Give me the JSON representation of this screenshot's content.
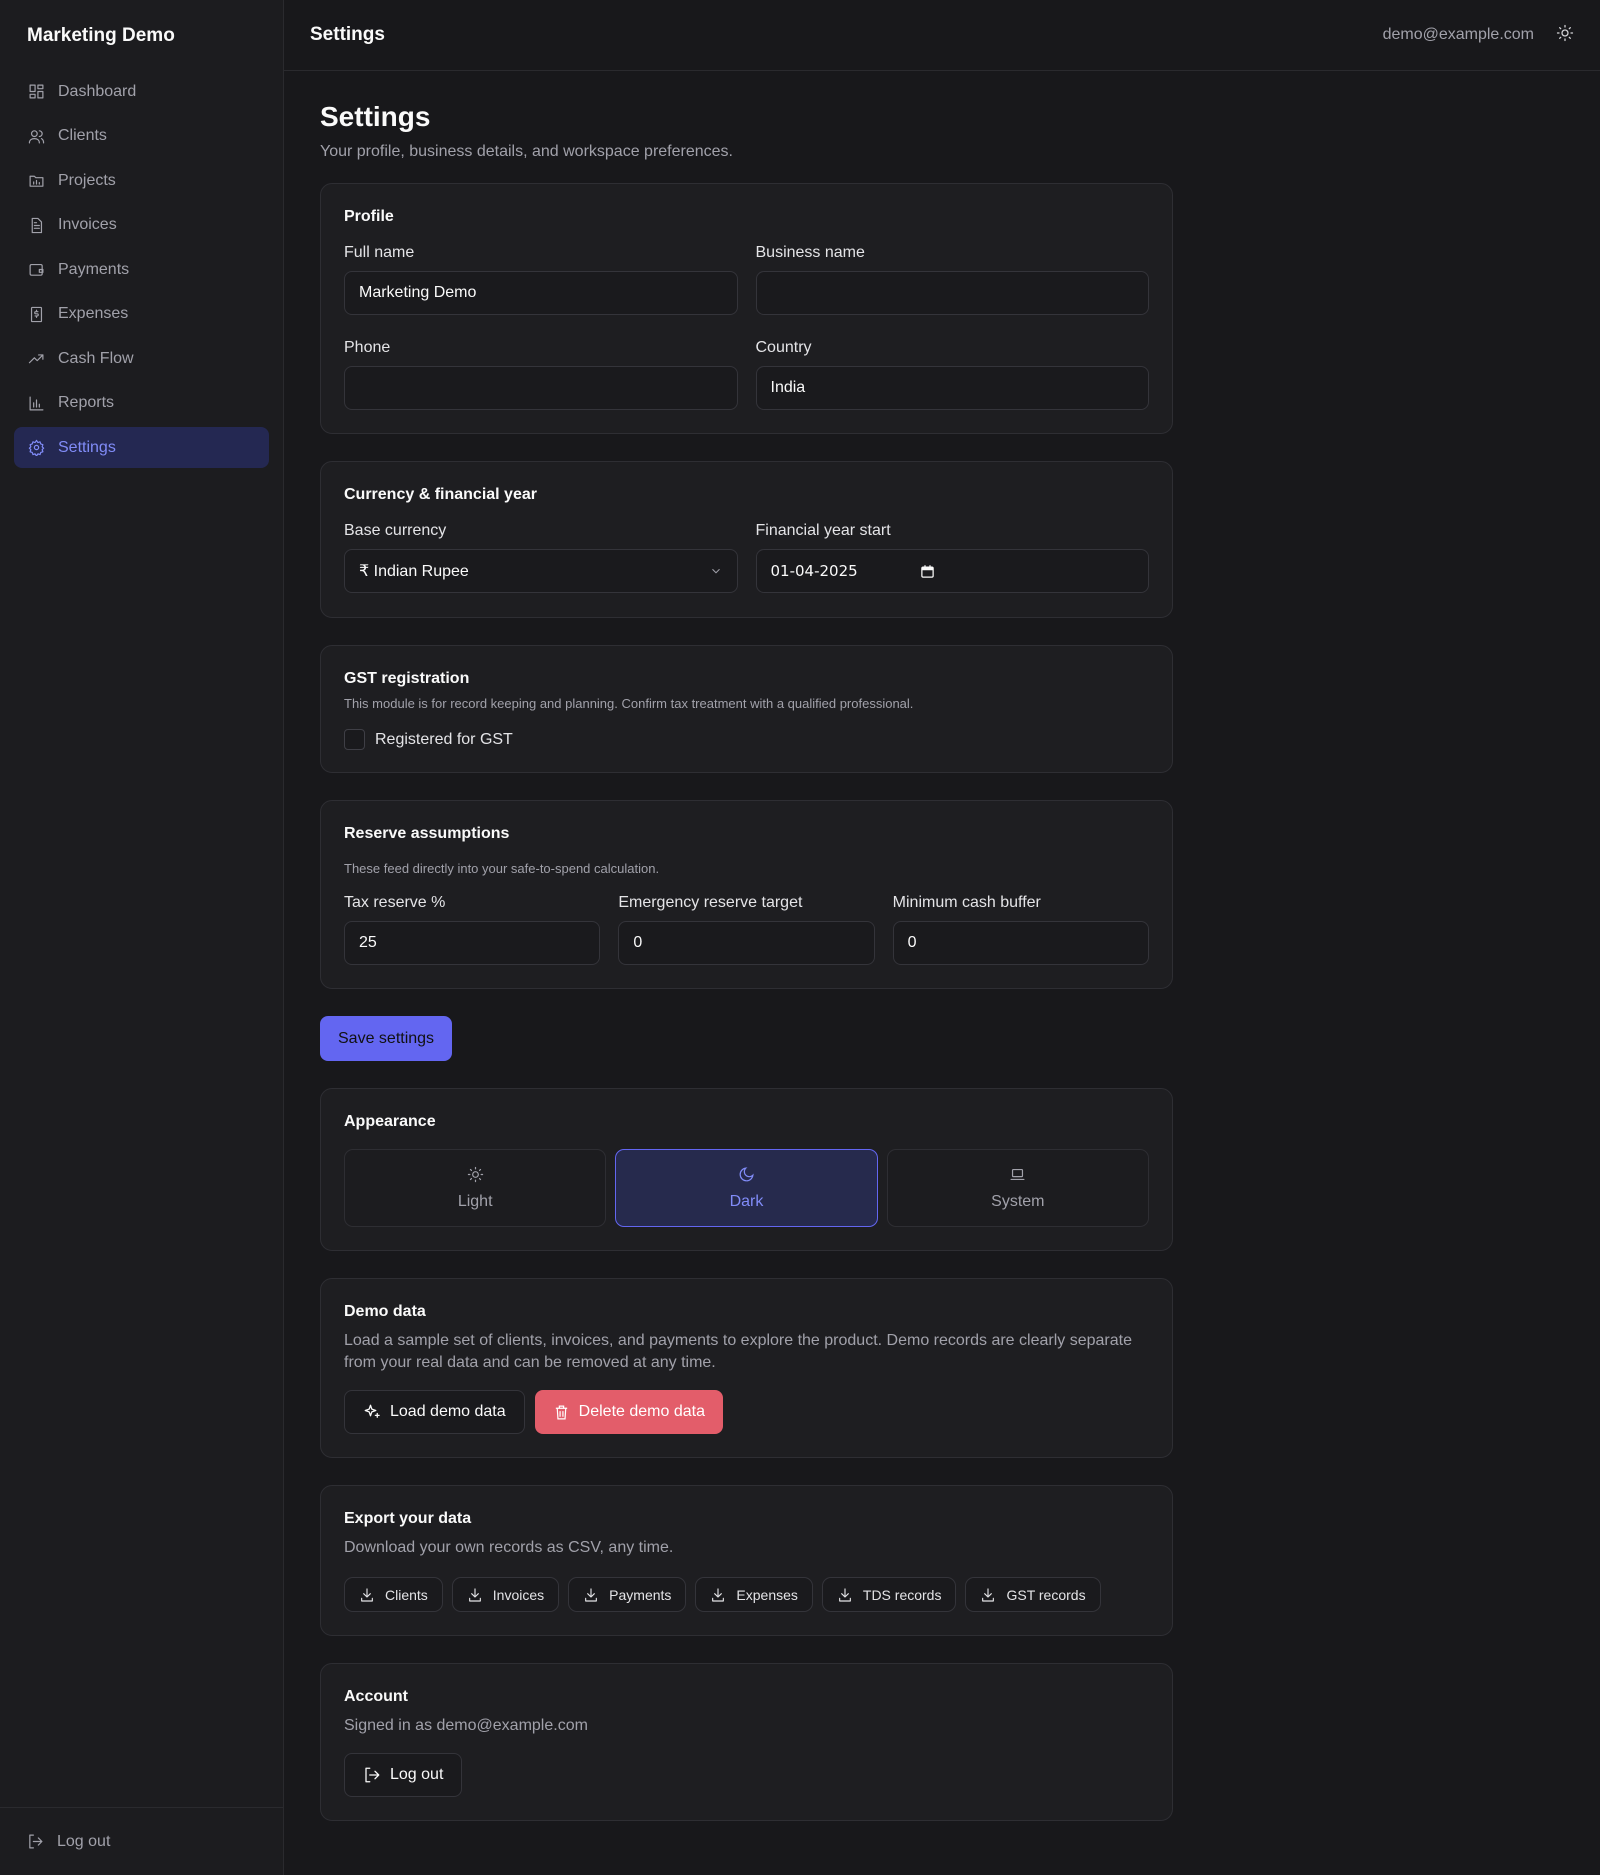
{
  "brand": "Marketing Demo",
  "sidebar": {
    "items": [
      {
        "label": "Dashboard",
        "icon": "dashboard-icon"
      },
      {
        "label": "Clients",
        "icon": "users-icon"
      },
      {
        "label": "Projects",
        "icon": "folder-icon"
      },
      {
        "label": "Invoices",
        "icon": "file-icon"
      },
      {
        "label": "Payments",
        "icon": "wallet-icon"
      },
      {
        "label": "Expenses",
        "icon": "receipt-icon"
      },
      {
        "label": "Cash Flow",
        "icon": "trending-up-icon"
      },
      {
        "label": "Reports",
        "icon": "bar-chart-icon"
      },
      {
        "label": "Settings",
        "icon": "gear-icon",
        "active": true
      }
    ],
    "logout": "Log out"
  },
  "topbar": {
    "title": "Settings",
    "email": "demo@example.com"
  },
  "page": {
    "title": "Settings",
    "subtitle": "Your profile, business details, and workspace preferences."
  },
  "profile": {
    "title": "Profile",
    "full_name_label": "Full name",
    "full_name_value": "Marketing Demo",
    "business_name_label": "Business name",
    "business_name_value": "",
    "phone_label": "Phone",
    "phone_value": "",
    "country_label": "Country",
    "country_value": "India"
  },
  "currency": {
    "title": "Currency & financial year",
    "base_currency_label": "Base currency",
    "base_currency_value": "₹ Indian Rupee",
    "fy_start_label": "Financial year start",
    "fy_start_value": "01-04-2025"
  },
  "gst": {
    "title": "GST registration",
    "desc": "This module is for record keeping and planning. Confirm tax treatment with a qualified professional.",
    "checkbox_label": "Registered for GST",
    "checked": false
  },
  "reserve": {
    "title": "Reserve assumptions",
    "desc": "These feed directly into your safe-to-spend calculation.",
    "tax_label": "Tax reserve %",
    "tax_value": "25",
    "emergency_label": "Emergency reserve target",
    "emergency_value": "0",
    "buffer_label": "Minimum cash buffer",
    "buffer_value": "0"
  },
  "save_label": "Save settings",
  "appearance": {
    "title": "Appearance",
    "options": [
      {
        "label": "Light",
        "icon": "sun-icon"
      },
      {
        "label": "Dark",
        "icon": "moon-icon",
        "active": true
      },
      {
        "label": "System",
        "icon": "laptop-icon"
      }
    ]
  },
  "demo": {
    "title": "Demo data",
    "desc": "Load a sample set of clients, invoices, and payments to explore the product. Demo records are clearly separate from your real data and can be removed at any time.",
    "load_label": "Load demo data",
    "delete_label": "Delete demo data"
  },
  "export": {
    "title": "Export your data",
    "desc": "Download your own records as CSV, any time.",
    "buttons": [
      "Clients",
      "Invoices",
      "Payments",
      "Expenses",
      "TDS records",
      "GST records"
    ]
  },
  "account": {
    "title": "Account",
    "desc": "Signed in as demo@example.com",
    "logout_label": "Log out"
  },
  "colors": {
    "accent": "#6366f1",
    "danger": "#e35d6a",
    "background": "#18181b"
  }
}
